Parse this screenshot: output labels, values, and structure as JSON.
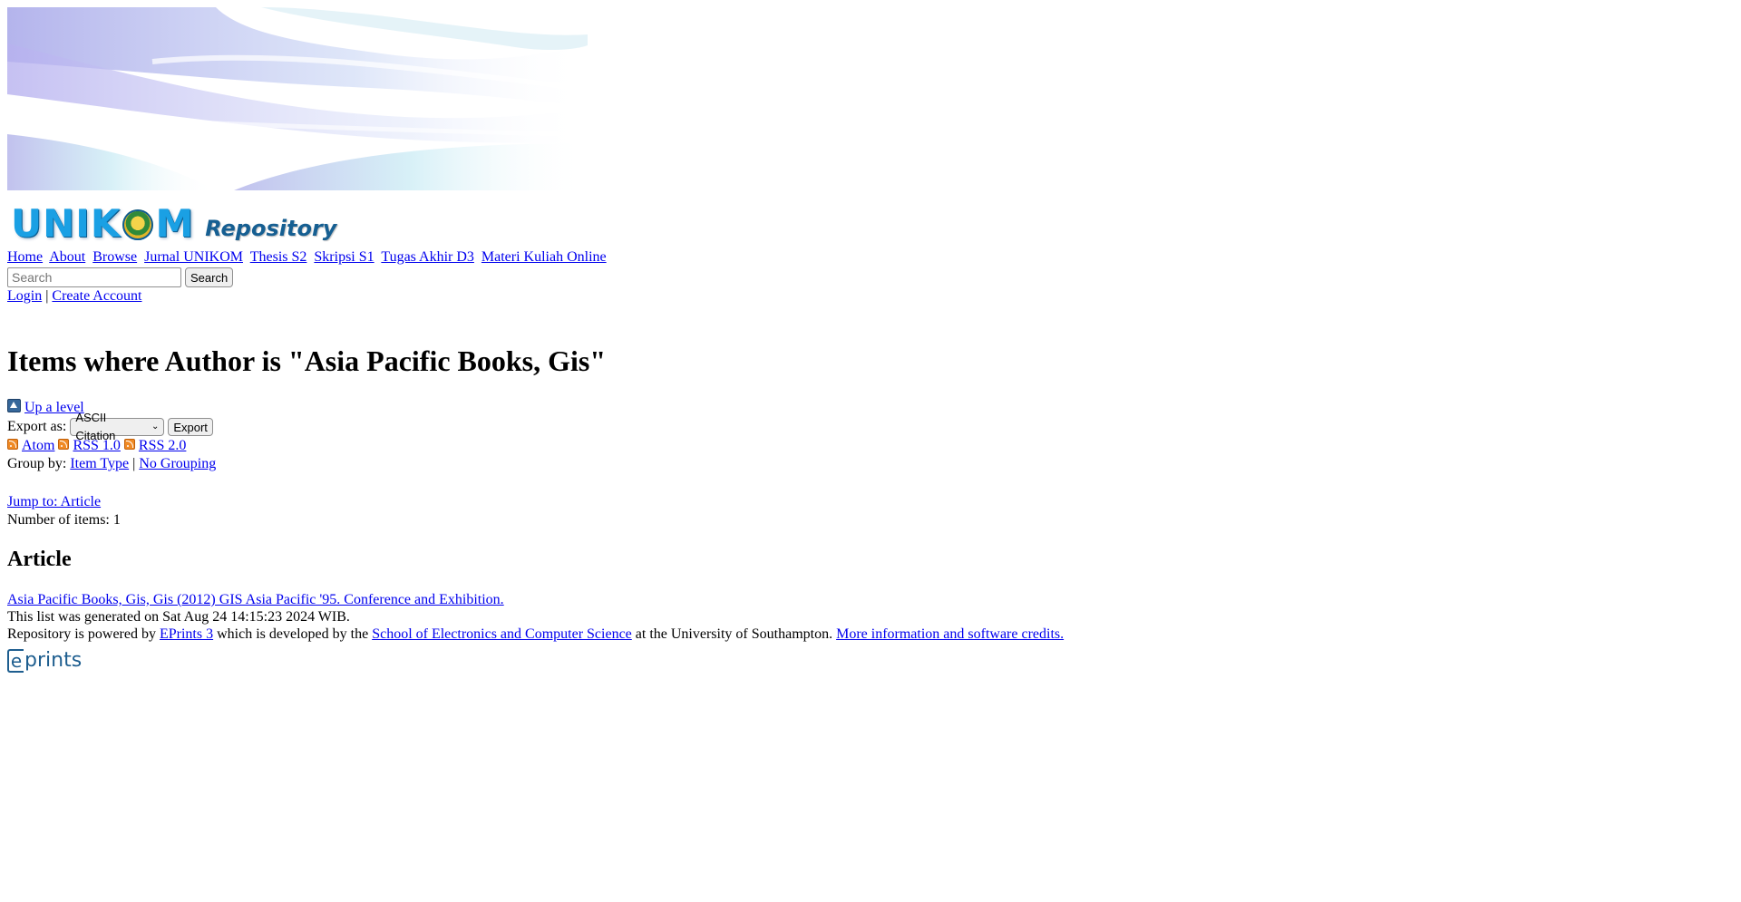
{
  "header": {
    "logo_main": "UNIK",
    "logo_main_end": "M",
    "logo_sub": "Repository"
  },
  "menu": {
    "items": [
      "Home",
      "About",
      "Browse",
      "Jurnal UNIKOM",
      "Thesis S2",
      "Skripsi S1",
      "Tugas Akhir D3",
      "Materi Kuliah Online"
    ]
  },
  "search": {
    "placeholder": "Search",
    "button_label": "Search"
  },
  "account": {
    "login": "Login",
    "separator": "|",
    "create": "Create Account"
  },
  "page": {
    "title": "Items where Author is \"Asia Pacific Books, Gis\""
  },
  "nav": {
    "up_level": "Up a level"
  },
  "export": {
    "label": "Export as:",
    "selected": "ASCII Citation",
    "button_label": "Export"
  },
  "feeds": {
    "atom": "Atom",
    "rss1": "RSS 1.0",
    "rss2": "RSS 2.0"
  },
  "grouping": {
    "label": "Group by:",
    "item_type": "Item Type",
    "separator": "|",
    "none": "No Grouping"
  },
  "results": {
    "jump": "Jump to: Article",
    "count": "Number of items: 1",
    "section_heading": "Article",
    "item_citation": "Asia Pacific Books, Gis, Gis (2012) GIS Asia Pacific '95. Conference and Exhibition."
  },
  "footer": {
    "generated": "This list was generated on Sat Aug 24 14:15:23 2024 WIB.",
    "powered_prefix": "Repository is powered by",
    "eprints_link": "EPrints 3",
    "developed_by": "which is developed by the",
    "school_link": "School of Electronics and Computer Science",
    "university": "at the University of Southampton.",
    "credits_link": "More information and software credits.",
    "logo_e": "e",
    "logo_prints": "prints"
  },
  "colors": {
    "link": "#0000ee",
    "logo_blue": "#1aa0e4",
    "eprints_blue": "#1e5e8f"
  }
}
